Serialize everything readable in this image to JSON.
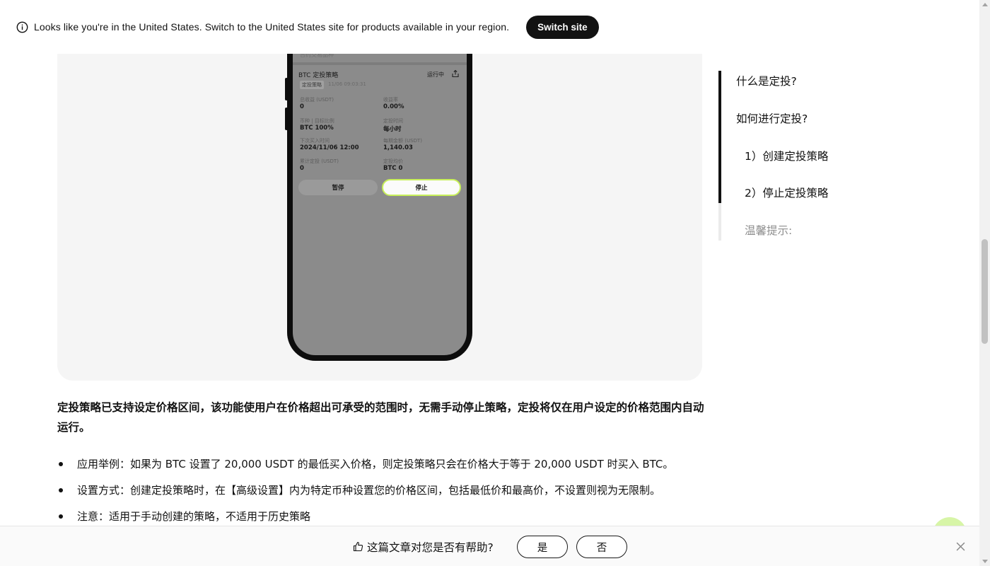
{
  "banner": {
    "message": "Looks like you're in the United States. Switch to the United States site for products available in your region.",
    "switch_label": "Switch site"
  },
  "phone": {
    "top_text": "合约交易品种",
    "strategy_title": "BTC 定投策略",
    "status": "运行中",
    "tag": "定投策略",
    "tag_date": "11/06 09:03:31",
    "fields": [
      {
        "label": "总收益 (USDT)",
        "value": "0"
      },
      {
        "label": "收益率",
        "value": "0.00%"
      },
      {
        "label": "币种 | 目标比例",
        "value": "BTC 100%"
      },
      {
        "label": "定投时间",
        "value": "每小时"
      },
      {
        "label": "下次买入时间",
        "value": "2024/11/06 12:00"
      },
      {
        "label": "每期金额 (USDT)",
        "value": "1,140.03"
      },
      {
        "label": "累计定投 (USDT)",
        "value": "0"
      },
      {
        "label": "定投均价",
        "value": "BTC 0"
      }
    ],
    "pause_label": "暂停",
    "stop_label": "停止",
    "accent_color": "#c8f05a"
  },
  "article": {
    "bold_paragraph": "定投策略已支持设定价格区间，该功能使用户在价格超出可承受的范围时，无需手动停止策略，定投将仅在用户设定的价格范围内自动运行。",
    "bullets": [
      "应用举例：如果为 BTC 设置了 20,000 USDT 的最低买入价格，则定投策略只会在价格大于等于 20,000 USDT 时买入 BTC。",
      "设置方式：创建定投策略时，在【高级设置】内为特定币种设置您的价格区间，包括最低价和最高价，不设置则视为无限制。",
      "注意：适用于手动创建的策略，不适用于历史策略"
    ]
  },
  "toc": {
    "items": [
      {
        "label": "什么是定投?"
      },
      {
        "label": "如何进行定投?"
      },
      {
        "label": "1）创建定投策略"
      },
      {
        "label": "2）停止定投策略"
      },
      {
        "label": "温馨提示:"
      }
    ]
  },
  "feedback": {
    "question": "这篇文章对您是否有帮助?",
    "yes_label": "是",
    "no_label": "否"
  },
  "icons": {
    "info": "info-icon",
    "thumbs_up": "thumbs-up-icon",
    "close": "close-icon",
    "share": "share-icon"
  }
}
